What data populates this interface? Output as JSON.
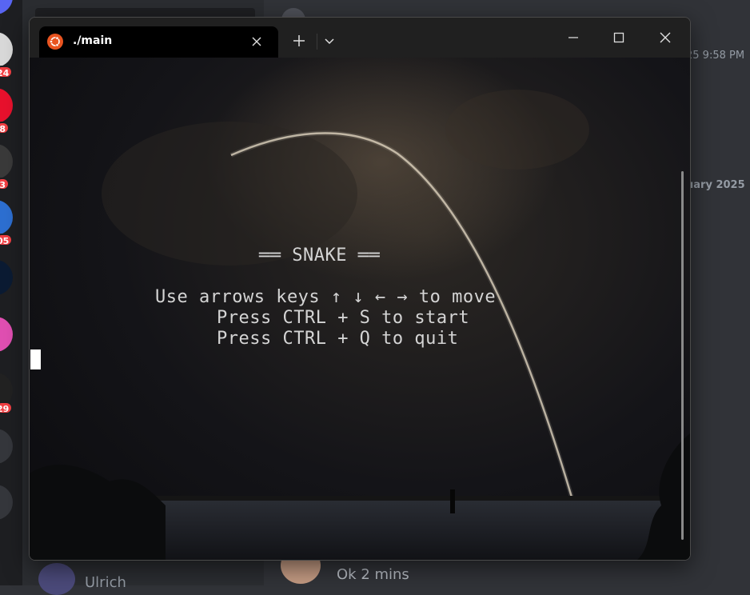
{
  "window": {
    "tab_title": "./main",
    "new_tab_symbol": "+",
    "dropdown_symbol": "⌄"
  },
  "terminal": {
    "lines": [
      "══ SNAKE ══",
      "Use arrows keys ↑ ↓ ← → to move",
      "Press CTRL + S to start",
      "Press CTRL + Q to quit"
    ]
  },
  "background_app": {
    "rail_badges": [
      "24",
      "8",
      "3",
      "05",
      "29"
    ],
    "timestamp_partial": "25 9:58 PM",
    "date_divider_partial": "uary 2025",
    "last_message": "Ok 2 mins",
    "user_name_partial": "Ulrich"
  },
  "colors": {
    "terminal_bg": "#202020",
    "tab_bg": "#000000",
    "ubuntu_orange": "#e95420",
    "discord_bg": "#313338",
    "badge_red": "#f23f43"
  },
  "icons": {
    "tab_icon": "ubuntu-logo-icon",
    "close": "close-icon",
    "minimize": "minimize-icon",
    "maximize": "maximize-icon"
  }
}
